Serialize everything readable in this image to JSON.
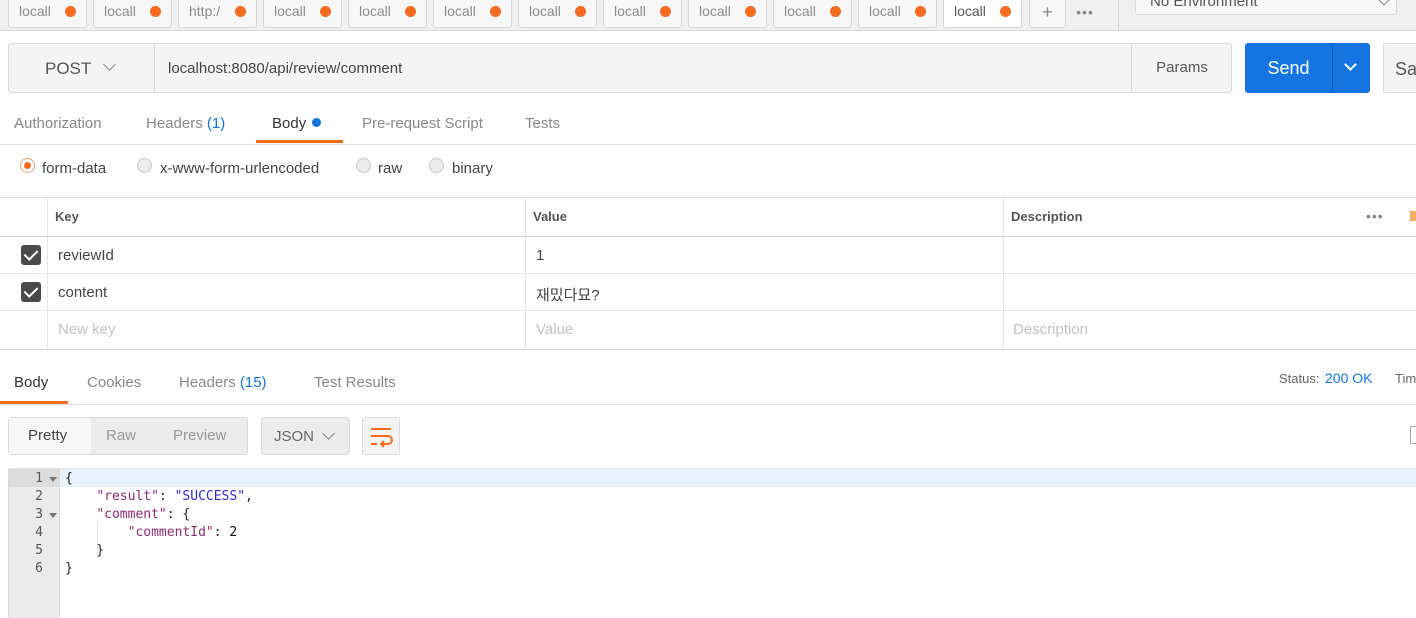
{
  "tabs": {
    "items": [
      {
        "label": "locall"
      },
      {
        "label": "locall"
      },
      {
        "label": "http:/"
      },
      {
        "label": "locall"
      },
      {
        "label": "locall"
      },
      {
        "label": "locall"
      },
      {
        "label": "locall"
      },
      {
        "label": "locall"
      },
      {
        "label": "locall"
      },
      {
        "label": "locall"
      },
      {
        "label": "locall"
      },
      {
        "label": "locall"
      }
    ],
    "add": "+",
    "more": "•••",
    "active_index": 11,
    "unsaved_dot_color": "#f26b21"
  },
  "environment": {
    "label": "No Environment"
  },
  "request": {
    "method": "POST",
    "url": "localhost:8080/api/review/comment",
    "params_label": "Params",
    "send_label": "Send",
    "save_label": "Save"
  },
  "request_tabs": [
    {
      "label": "Authorization"
    },
    {
      "label": "Headers",
      "count": "(1)"
    },
    {
      "label": "Body",
      "active": true
    },
    {
      "label": "Pre-request Script"
    },
    {
      "label": "Tests"
    }
  ],
  "body_types": [
    {
      "label": "form-data",
      "checked": true
    },
    {
      "label": "x-www-form-urlencoded"
    },
    {
      "label": "raw"
    },
    {
      "label": "binary"
    }
  ],
  "form_table": {
    "headers": [
      "Key",
      "Value",
      "Description"
    ],
    "more": "•••",
    "rows": [
      {
        "key": "reviewId",
        "value": "1",
        "description": "",
        "checked": true
      },
      {
        "key": "content",
        "value": "재밌다묘?",
        "description": "",
        "checked": true
      }
    ],
    "placeholders": {
      "key": "New key",
      "value": "Value",
      "description": "Description"
    }
  },
  "response": {
    "tabs": [
      {
        "label": "Body",
        "active": true
      },
      {
        "label": "Cookies"
      },
      {
        "label": "Headers",
        "count": "(15)"
      },
      {
        "label": "Test Results"
      }
    ],
    "status_label": "Status:",
    "status_value": "200 OK",
    "time_label": "Time",
    "views": [
      "Pretty",
      "Raw",
      "Preview"
    ],
    "active_view": "Pretty",
    "format": "JSON",
    "code_lines": [
      {
        "n": "1",
        "fold": true
      },
      {
        "n": "2"
      },
      {
        "n": "3",
        "fold": true
      },
      {
        "n": "4"
      },
      {
        "n": "5"
      },
      {
        "n": "6"
      }
    ],
    "code": {
      "result_key": "\"result\"",
      "result_value": "\"SUCCESS\"",
      "comment_key": "\"comment\"",
      "comment_id_key": "\"commentId\"",
      "comment_id_value": "2"
    }
  },
  "colors": {
    "accent": "#f26b21",
    "primary": "#1475e1"
  }
}
